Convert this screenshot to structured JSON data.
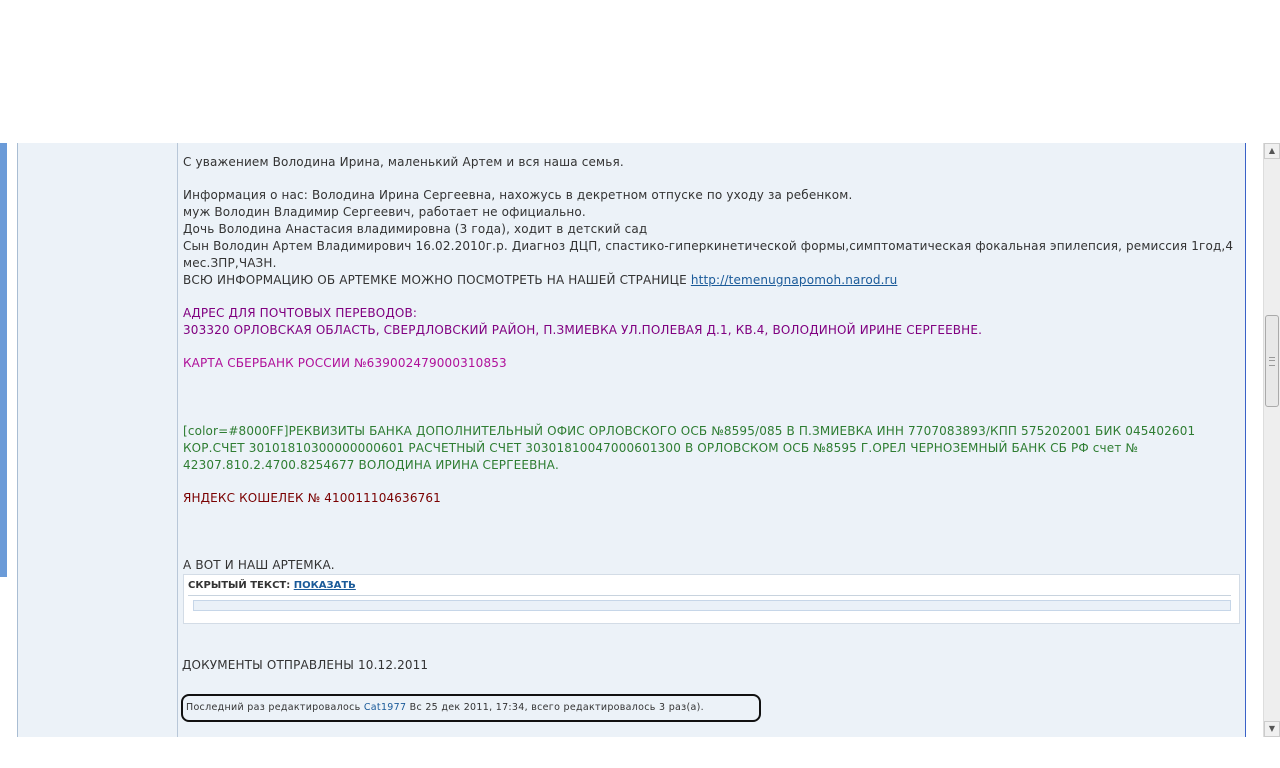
{
  "post": {
    "lines": {
      "greeting": "С уважением Володина Ирина, маленький Артем и вся наша семья.",
      "info": "Информация о нас: Володина Ирина Сергеевна, нахожусь в декретном отпуске по уходу за ребенком.",
      "husband": "муж Володин Владимир Сергеевич, работает не официально.",
      "daughter": "Дочь Володина Анастасия владимировна (3 года), ходит в детский сад",
      "son_1": "Сын Володин Артем Владимирович 16.02.2010г.р. Диагноз ДЦП, спастико-гиперкинетической формы,симптоматическая фокальная эпилепсия, ремиссия 1год,4",
      "son_2": "мес.ЗПР,ЧАЗН.",
      "page_prefix": "ВСЮ ИНФОРМАЦИЮ ОБ АРТЕМКЕ МОЖНО ПОСМОТРЕТЬ НА НАШЕЙ СТРАНИЦЕ ",
      "page_link": "http://temenugnapomoh.narod.ru",
      "address_title": "АДРЕС ДЛЯ ПОЧТОВЫХ ПЕРЕВОДОВ:",
      "address": "303320 ОРЛОВСКАЯ ОБЛАСТЬ, СВЕРДЛОВСКИЙ РАЙОН, П.ЗМИЕВКА УЛ.ПОЛЕВАЯ Д.1, КВ.4, ВОЛОДИНОЙ ИРИНЕ СЕРГЕЕВНЕ.",
      "card": "КАРТА СБЕРБАНК РОССИИ №639002479000310853",
      "bank_1": "[color=#8000FF]РЕКВИЗИТЫ БАНКА ДОПОЛНИТЕЛЬНЫЙ ОФИС ОРЛОВСКОГО ОСБ №8595/085 В П.ЗМИЕВКА ИНН 7707083893/КПП 575202001 БИК 045402601",
      "bank_2": "КОР.СЧЕТ 30101810300000000601 РАСЧЕТНЫЙ СЧЕТ 30301810047000601300 В ОРЛОВСКОМ ОСБ №8595 Г.ОРЕЛ ЧЕРНОЗЕМНЫЙ БАНК СБ РФ счет №",
      "bank_3": "42307.810.2.4700.8254677 ВОЛОДИНА ИРИНА СЕРГЕЕВНА.",
      "yandex": "ЯНДЕКС КОШЕЛЕК № 410011104636761",
      "artem": "А ВОТ И НАШ АРТЕМКА.",
      "documents": "ДОКУМЕНТЫ ОТПРАВЛЕНЫ 10.12.2011"
    },
    "hidden": {
      "label": "СКРЫТЫЙ ТЕКСТ:",
      "show_link": "ПОКАЗАТЬ"
    },
    "edit_note": {
      "prefix": "Последний раз редактировалось ",
      "user": "Cat1977",
      "suffix": " Вс 25 дек 2011, 17:34, всего редактировалось 3 раз(а)."
    }
  },
  "colors": {
    "address": "#800080",
    "card": "#b0109a",
    "bank": "#2e7d32",
    "yandex": "#7a0000",
    "link": "#1a5a99",
    "post_background": "#ecf2f8"
  },
  "scrollbar": {
    "up_icon": "triangle-up",
    "down_icon": "triangle-down"
  }
}
